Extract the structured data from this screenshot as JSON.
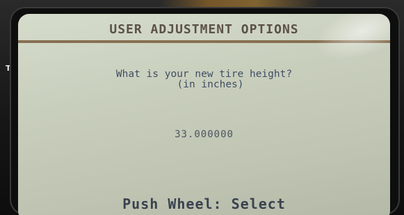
{
  "screen": {
    "title": "USER ADJUSTMENT OPTIONS",
    "prompt_line1": "What is your new tire height?",
    "prompt_line2": "(in inches)",
    "value": "33.000000",
    "footer": "Push Wheel: Select"
  },
  "colors": {
    "lcd_background": "#c9cfbd",
    "title_text": "#5b5148",
    "header_rule": "#7a5e3d",
    "prompt_text": "#3f4d63",
    "footer_text": "#3a4250"
  }
}
